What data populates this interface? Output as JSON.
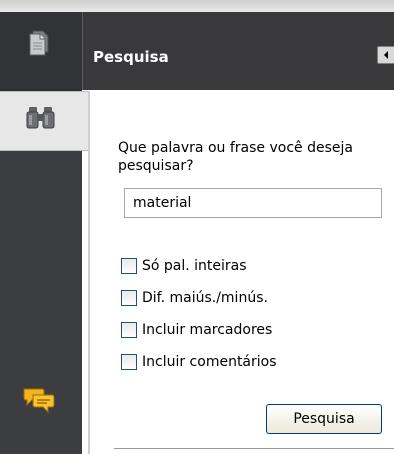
{
  "panel": {
    "title": "Pesquisa",
    "prompt": "Que palavra ou frase você deseja pesquisar?",
    "search_value": "material",
    "options": [
      {
        "label": "Só pal. inteiras",
        "checked": false
      },
      {
        "label": "Dif. maiús./minús.",
        "checked": false
      },
      {
        "label": "Incluir marcadores",
        "checked": false
      },
      {
        "label": "Incluir comentários",
        "checked": false
      }
    ],
    "search_button_label": "Pesquisa"
  },
  "sidebar": {
    "icons": [
      "pages-icon",
      "binoculars-icon",
      "comments-icon"
    ]
  },
  "colors": {
    "rail": "#3c3d40",
    "header": "#39393b",
    "active_tab": "#e7e7e8",
    "checkbox_border": "#1c5180"
  }
}
